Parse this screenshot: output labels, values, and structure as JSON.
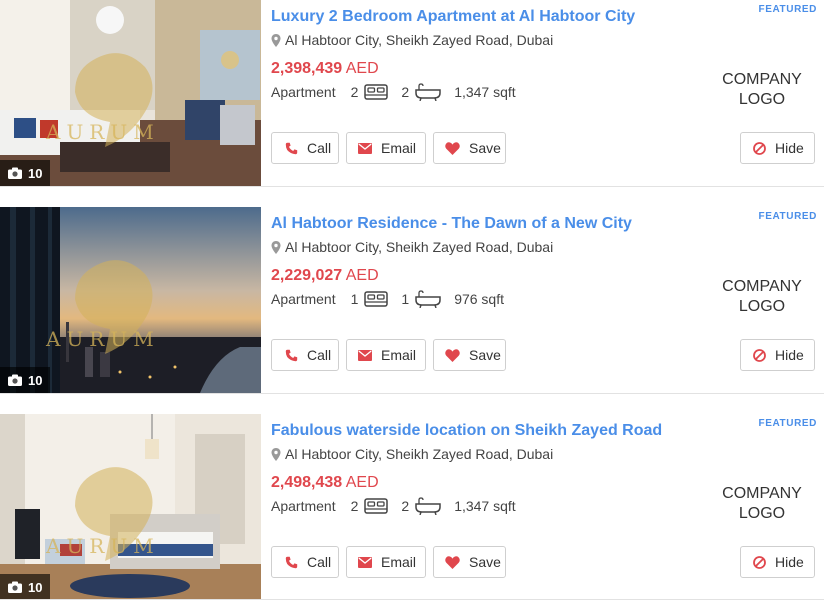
{
  "listings": [
    {
      "title": "Luxury 2 Bedroom Apartment at Al Habtoor City",
      "badge": "FEATURED",
      "location": "Al Habtoor City, Sheikh Zayed Road, Dubai",
      "price": "2,398,439",
      "currency": "AED",
      "type": "Apartment",
      "bedrooms": "2",
      "bathrooms": "2",
      "area": "1,347 sqft",
      "photo_count": "10",
      "watermark": "AURUM",
      "company_logo": [
        "COMPANY",
        "LOGO"
      ],
      "actions": {
        "call": "Call",
        "email": "Email",
        "save": "Save",
        "hide": "Hide"
      }
    },
    {
      "title": "Al Habtoor Residence - The Dawn of a New City",
      "badge": "FEATURED",
      "location": "Al Habtoor City, Sheikh Zayed Road, Dubai",
      "price": "2,229,027",
      "currency": "AED",
      "type": "Apartment",
      "bedrooms": "1",
      "bathrooms": "1",
      "area": "976 sqft",
      "photo_count": "10",
      "watermark": "AURUM",
      "company_logo": [
        "COMPANY",
        "LOGO"
      ],
      "actions": {
        "call": "Call",
        "email": "Email",
        "save": "Save",
        "hide": "Hide"
      }
    },
    {
      "title": "Fabulous waterside location on Sheikh Zayed Road",
      "badge": "FEATURED",
      "location": "Al Habtoor City, Sheikh Zayed Road, Dubai",
      "price": "2,498,438",
      "currency": "AED",
      "type": "Apartment",
      "bedrooms": "2",
      "bathrooms": "2",
      "area": "1,347 sqft",
      "photo_count": "10",
      "watermark": "AURUM",
      "company_logo": [
        "COMPANY",
        "LOGO"
      ],
      "actions": {
        "call": "Call",
        "email": "Email",
        "save": "Save",
        "hide": "Hide"
      }
    }
  ],
  "icons": {
    "camera": "camera-icon",
    "location": "map-pin-icon",
    "bed": "bed-icon",
    "bath": "bathtub-icon",
    "call": "phone-icon",
    "email": "envelope-icon",
    "save": "heart-icon",
    "hide": "ban-icon"
  },
  "colors": {
    "title": "#4a8ee8",
    "price": "#e0474d",
    "icon_accent": "#e0474d"
  }
}
